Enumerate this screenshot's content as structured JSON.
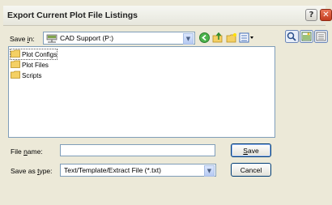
{
  "window": {
    "title": "Export Current Plot File Listings",
    "help_glyph": "?",
    "close_glyph": "✕"
  },
  "save_in": {
    "label_pre": "Save ",
    "label_u": "i",
    "label_post": "n:",
    "value": "CAD Support (P:)"
  },
  "toolbar_icons": [
    "back-icon",
    "up-folder-icon",
    "new-folder-icon",
    "views-menu-icon"
  ],
  "side_icons": [
    "search-web-icon",
    "preview-icon",
    "details-icon"
  ],
  "files": [
    {
      "name": "Plot Configs",
      "selected": true
    },
    {
      "name": "Plot Files",
      "selected": false
    },
    {
      "name": "Scripts",
      "selected": false
    }
  ],
  "file_name": {
    "label_pre": "File ",
    "label_u": "n",
    "label_post": "ame:",
    "value": ""
  },
  "save_type": {
    "label_pre": "Save as ",
    "label_u": "t",
    "label_post": "ype:",
    "value": "Text/Template/Extract File (*.txt)"
  },
  "buttons": {
    "save_u": "S",
    "save_rest": "ave",
    "cancel": "Cancel"
  },
  "colors": {
    "dialog_bg": "#ece9d8",
    "border": "#7f9db9",
    "folder": "#f4d064"
  }
}
